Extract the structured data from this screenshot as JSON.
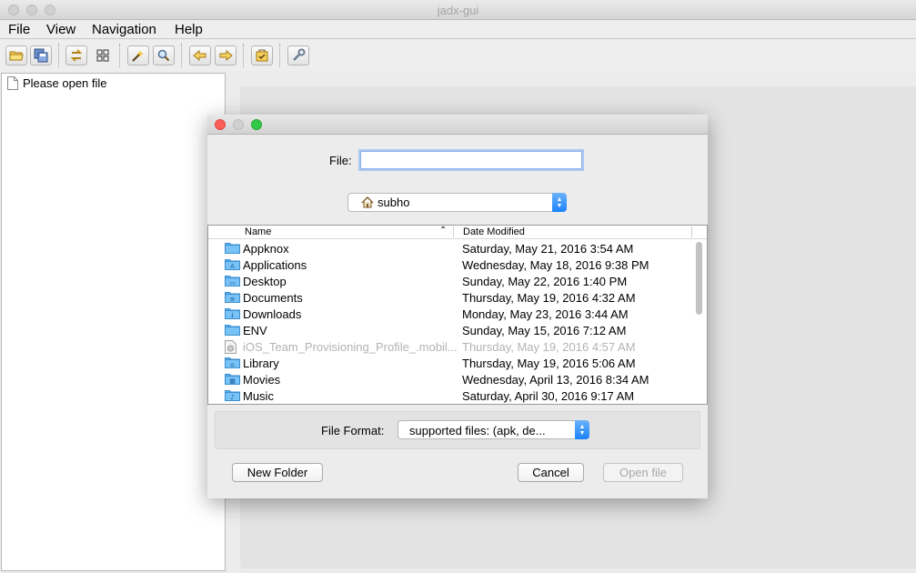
{
  "window": {
    "title": "jadx-gui"
  },
  "menubar": {
    "items": [
      "File",
      "View",
      "Navigation",
      "Help"
    ]
  },
  "toolbar": {
    "icons": [
      "open-file-icon",
      "save-all-icon",
      "sync-icon",
      "flatten-packages-icon",
      "search-text-icon",
      "search-class-icon",
      "back-icon",
      "forward-icon",
      "log-icon",
      "preferences-icon"
    ]
  },
  "tree": {
    "placeholder": "Please open file"
  },
  "dialog": {
    "file_label": "File:",
    "file_value": "",
    "location": "subho",
    "columns": {
      "name": "Name",
      "date": "Date Modified"
    },
    "files": [
      {
        "name": "Appknox",
        "date": "Saturday, May 21, 2016 3:54 AM",
        "icon": "folder-icon",
        "disabled": false
      },
      {
        "name": "Applications",
        "date": "Wednesday, May 18, 2016 9:38 PM",
        "icon": "applications-folder-icon",
        "disabled": false
      },
      {
        "name": "Desktop",
        "date": "Sunday, May 22, 2016 1:40 PM",
        "icon": "desktop-folder-icon",
        "disabled": false
      },
      {
        "name": "Documents",
        "date": "Thursday, May 19, 2016 4:32 AM",
        "icon": "documents-folder-icon",
        "disabled": false
      },
      {
        "name": "Downloads",
        "date": "Monday, May 23, 2016 3:44 AM",
        "icon": "downloads-folder-icon",
        "disabled": false
      },
      {
        "name": "ENV",
        "date": "Sunday, May 15, 2016 7:12 AM",
        "icon": "folder-icon",
        "disabled": false
      },
      {
        "name": "iOS_Team_Provisioning_Profile_.mobil...",
        "date": "Thursday, May 19, 2016 4:57 AM",
        "icon": "provisioning-file-icon",
        "disabled": true
      },
      {
        "name": "Library",
        "date": "Thursday, May 19, 2016 5:06 AM",
        "icon": "library-folder-icon",
        "disabled": false
      },
      {
        "name": "Movies",
        "date": "Wednesday, April 13, 2016 8:34 AM",
        "icon": "movies-folder-icon",
        "disabled": false
      },
      {
        "name": "Music",
        "date": "Saturday, April 30, 2016 9:17 AM",
        "icon": "music-folder-icon",
        "disabled": false
      }
    ],
    "format_label": "File Format:",
    "format_value": "supported files: (apk, de...",
    "buttons": {
      "new_folder": "New Folder",
      "cancel": "Cancel",
      "open": "Open file"
    }
  },
  "colors": {
    "folder": "#5fb4f0",
    "accent": "#1a82fb"
  }
}
